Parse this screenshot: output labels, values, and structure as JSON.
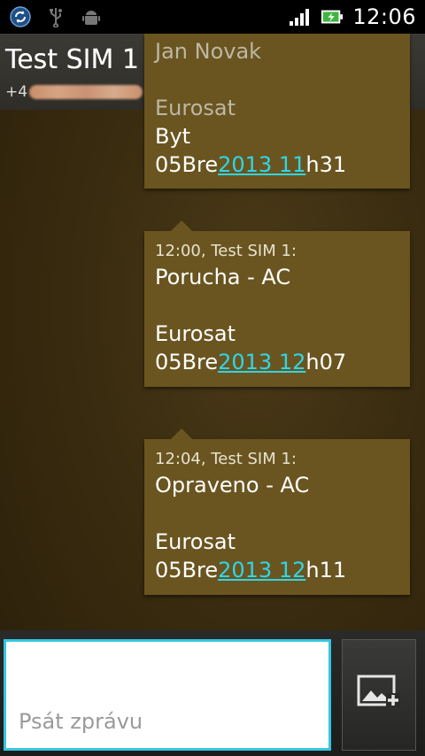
{
  "status_bar": {
    "icons_left": [
      "sync-icon",
      "usb-icon",
      "android-debug-icon"
    ],
    "icons_right": [
      "signal-icon",
      "battery-charging-icon"
    ],
    "clock": "12:06"
  },
  "header": {
    "title": "Test SIM 1",
    "number_prefix": "+4"
  },
  "messages": [
    {
      "lines": [
        "Jan Novak",
        "",
        "Eurosat",
        "Byt"
      ],
      "last_pre": "05Bre",
      "last_link": "2013 11",
      "last_post": "h31"
    },
    {
      "meta": "12:00, Test SIM 1:",
      "lines": [
        "Porucha - AC",
        "",
        "Eurosat"
      ],
      "last_pre": "05Bre",
      "last_link": "2013 12",
      "last_post": "h07"
    },
    {
      "meta": "12:04, Test SIM 1:",
      "lines": [
        "Opraveno - AC",
        "",
        "Eurosat"
      ],
      "last_pre": "05Bre",
      "last_link": "2013 12",
      "last_post": "h11"
    }
  ],
  "composer": {
    "placeholder": "Psát zprávu",
    "attach_icon": "add-attachment-icon"
  },
  "colors": {
    "bubble": "#6a5520",
    "link": "#2fd6e6",
    "input_border": "#34c6e0"
  }
}
